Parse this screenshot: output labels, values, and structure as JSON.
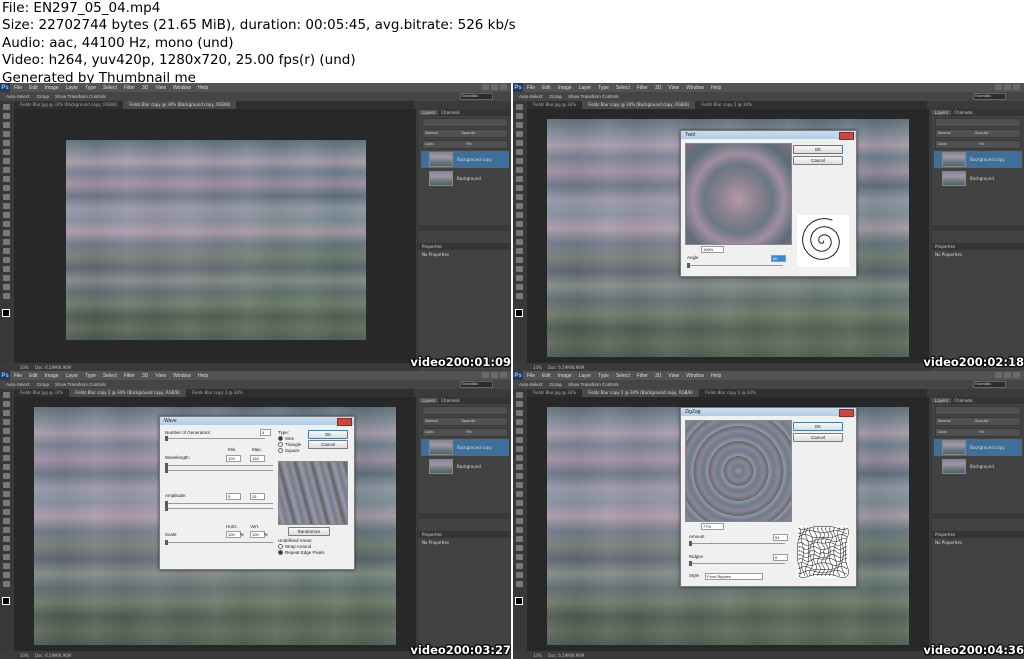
{
  "header": {
    "lines": [
      "File: EN297_05_04.mp4",
      "Size: 22702744 bytes (21.65 MiB), duration: 00:05:45, avg.bitrate: 526 kb/s",
      "Audio: aac, 44100 Hz, mono (und)",
      "Video: h264, yuv420p, 1280x720, 25.00 fps(r) (und)",
      "Generated by Thumbnail me"
    ]
  },
  "app": {
    "logo": "Ps",
    "menu": [
      "File",
      "Edit",
      "Image",
      "Layer",
      "Type",
      "Select",
      "Filter",
      "3D",
      "View",
      "Window",
      "Help"
    ],
    "options": [
      "Auto-Select:",
      "Group",
      "Show Transform Controls"
    ],
    "workspace": "Essentials",
    "layers_tabs": [
      "Layers",
      "Channels"
    ],
    "blend_mode": "Normal",
    "opacity_label": "Opacity:",
    "fill_label": "Fill:",
    "lock_label": "Lock:",
    "layers": [
      "Background copy",
      "Background"
    ],
    "properties_title": "Properties",
    "properties_sub": "No Properties",
    "zoom": "33%",
    "doc_info": "Doc: 6.59M/8.96M"
  },
  "frames": [
    {
      "tabs": [
        "Fields Blur.jpg @ 33% (Background copy, RGB/8)",
        "Fields Blur copy @ 34% (Background copy, RGB/8)"
      ],
      "timestamp": "00:01:09",
      "watermark": "video2"
    },
    {
      "tabs": [
        "Fields Blur.jpg @ 33%",
        "Fields Blur copy @ 34% (Background copy, RGB/8)",
        "Fields Blur copy 2 @ 34%"
      ],
      "timestamp": "00:02:18",
      "watermark": "video2",
      "dialog": {
        "title": "Twirl",
        "ok": "OK",
        "cancel": "Cancel",
        "zoom": "100%",
        "angle_label": "Angle",
        "angle_value": "50"
      }
    },
    {
      "tabs": [
        "Fields Blur.jpg @ 33%",
        "Fields Blur copy 2 @ 34% (Background copy, RGB/8)",
        "Fields Blur copy 2 @ 34%"
      ],
      "timestamp": "00:03:27",
      "watermark": "video2",
      "dialog": {
        "title": "Wave",
        "ok": "OK",
        "cancel": "Cancel",
        "generators_label": "Number of Generators:",
        "generators_value": "5",
        "min": "Min.",
        "max": "Max.",
        "wavelength_label": "Wavelength:",
        "wavelength_min": "109",
        "wavelength_max": "168",
        "amplitude_label": "Amplitude:",
        "amplitude_min": "5",
        "amplitude_max": "25",
        "scale_label": "Scale:",
        "horiz": "Horiz.",
        "vert": "Vert.",
        "scale_h": "100",
        "scale_v": "100",
        "pct": "%",
        "type_label": "Type:",
        "types": [
          "Sine",
          "Triangle",
          "Square"
        ],
        "randomize": "Randomize",
        "undefined_label": "Undefined Areas:",
        "undefined_options": [
          "Wrap Around",
          "Repeat Edge Pixels"
        ]
      }
    },
    {
      "tabs": [
        "Fields Blur.jpg @ 33%",
        "Fields Blur copy 2 @ 34% (Background copy, RGB/8)",
        "Fields Blur copy 2 @ 34%"
      ],
      "timestamp": "00:04:36",
      "watermark": "video2",
      "dialog": {
        "title": "ZigZag",
        "ok": "OK",
        "cancel": "Cancel",
        "zoom": "77%",
        "amount_label": "Amount",
        "amount_value": "54",
        "ridges_label": "Ridges",
        "ridges_value": "5",
        "style_label": "Style",
        "style_value": "Pond Ripples"
      }
    }
  ]
}
